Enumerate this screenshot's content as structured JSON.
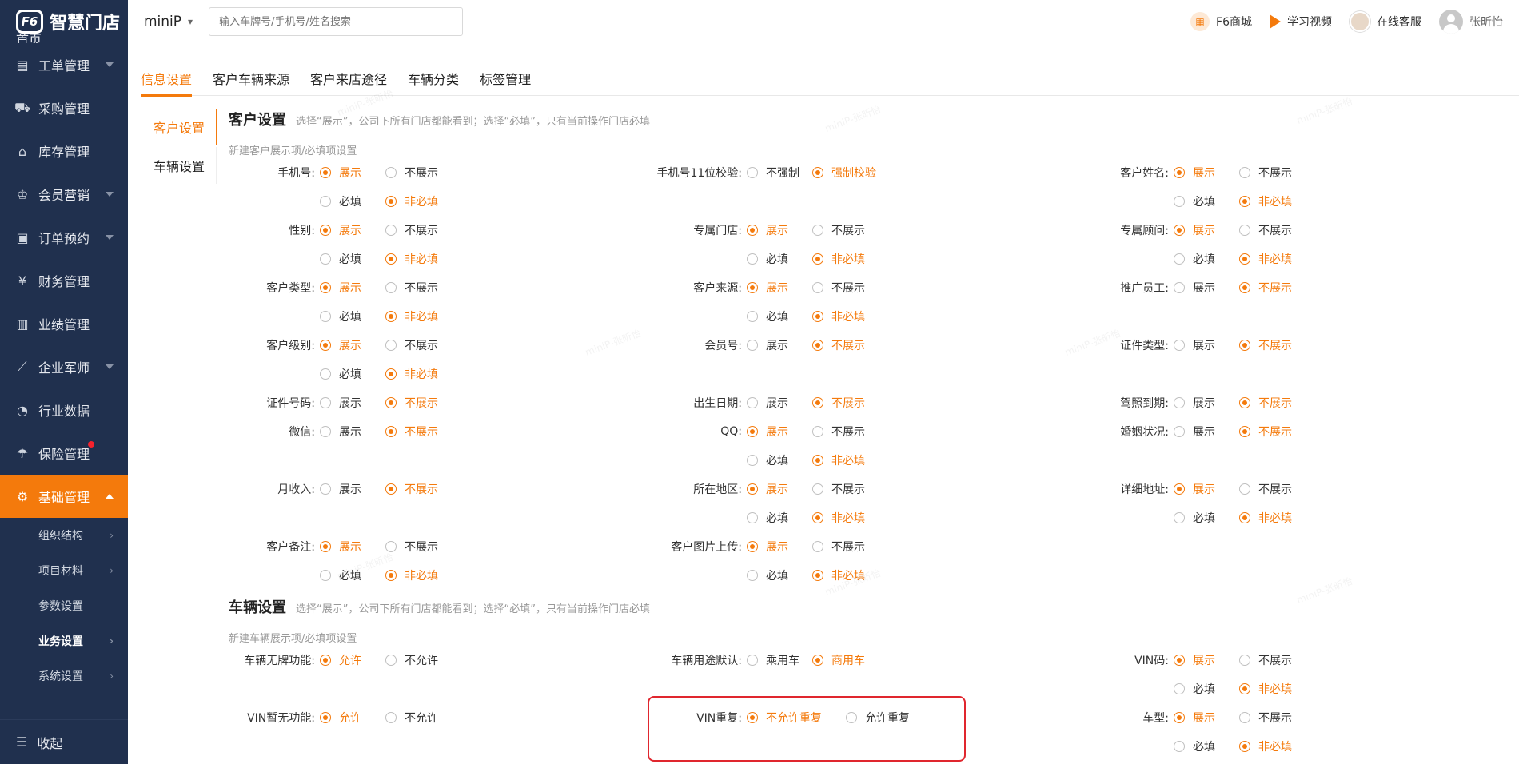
{
  "brand": {
    "name": "智慧门店"
  },
  "sidebar": {
    "partial_item": "首页",
    "items": [
      {
        "label": "工单管理",
        "icon": "doc-icon",
        "caret": true
      },
      {
        "label": "采购管理",
        "icon": "cart-icon",
        "caret": false
      },
      {
        "label": "库存管理",
        "icon": "house-icon",
        "caret": false
      },
      {
        "label": "会员营销",
        "icon": "crown-icon",
        "caret": true
      },
      {
        "label": "订单预约",
        "icon": "clipboard-icon",
        "caret": true
      },
      {
        "label": "财务管理",
        "icon": "yen-icon",
        "caret": false
      },
      {
        "label": "业绩管理",
        "icon": "bar-chart-icon",
        "caret": false
      },
      {
        "label": "企业军师",
        "icon": "trend-icon",
        "caret": true
      },
      {
        "label": "行业数据",
        "icon": "gauge-icon",
        "caret": false
      },
      {
        "label": "保险管理",
        "icon": "umbrella-icon",
        "caret": false
      },
      {
        "label": "基础管理",
        "icon": "gear-icon",
        "caret": true
      }
    ],
    "sub_items": [
      "组织结构",
      "项目材料",
      "参数设置",
      "业务设置",
      "系统设置"
    ],
    "collapse_label": "收起"
  },
  "topbar": {
    "store": "miniP",
    "search_placeholder": "输入车牌号/手机号/姓名搜索",
    "links": {
      "mall": "F6商城",
      "video": "学习视频",
      "service": "在线客服"
    },
    "user": "张昕怡"
  },
  "tabs": [
    "信息设置",
    "客户车辆来源",
    "客户来店途径",
    "车辆分类",
    "标签管理"
  ],
  "subnav": [
    "客户设置",
    "车辆设置"
  ],
  "customer": {
    "title": "客户设置",
    "hint": "选择“展示”，公司下所有门店都能看到；选择“必填”，只有当前操作门店必填",
    "sub": "新建客户展示项/必填项设置",
    "c1": [
      {
        "label": "手机号:",
        "show": "展示",
        "hide": "不展示",
        "req": "必填",
        "opt": "非必填"
      },
      {
        "label": "性别:",
        "show": "展示",
        "hide": "不展示",
        "req": "必填",
        "opt": "非必填"
      },
      {
        "label": "客户类型:",
        "show": "展示",
        "hide": "不展示",
        "req": "必填",
        "opt": "非必填"
      },
      {
        "label": "客户级别:",
        "show": "展示",
        "hide": "不展示",
        "req": "必填",
        "opt": "非必填"
      },
      {
        "label": "证件号码:",
        "show": "展示",
        "hide": "不展示"
      },
      {
        "label": "微信:",
        "show": "展示",
        "hide": "不展示"
      },
      {
        "label": "月收入:",
        "show": "展示",
        "hide": "不展示"
      },
      {
        "label": "客户备注:",
        "show": "展示",
        "hide": "不展示",
        "req": "必填",
        "opt": "非必填"
      }
    ],
    "c2": [
      {
        "label": "手机号11位校验:",
        "a": "不强制",
        "b": "强制校验"
      },
      {
        "label": "专属门店:",
        "show": "展示",
        "hide": "不展示",
        "req": "必填",
        "opt": "非必填"
      },
      {
        "label": "客户来源:",
        "show": "展示",
        "hide": "不展示",
        "req": "必填",
        "opt": "非必填"
      },
      {
        "label": "会员号:",
        "show": "展示",
        "hide": "不展示"
      },
      {
        "label": "出生日期:",
        "show": "展示",
        "hide": "不展示"
      },
      {
        "label": "QQ:",
        "show": "展示",
        "hide": "不展示",
        "req": "必填",
        "opt": "非必填"
      },
      {
        "label": "所在地区:",
        "show": "展示",
        "hide": "不展示",
        "req": "必填",
        "opt": "非必填"
      },
      {
        "label": "客户图片上传:",
        "show": "展示",
        "hide": "不展示",
        "req": "必填",
        "opt": "非必填"
      }
    ],
    "c3": [
      {
        "label": "客户姓名:",
        "show": "展示",
        "hide": "不展示",
        "req": "必填",
        "opt": "非必填"
      },
      {
        "label": "专属顾问:",
        "show": "展示",
        "hide": "不展示",
        "req": "必填",
        "opt": "非必填"
      },
      {
        "label": "推广员工:",
        "show": "展示",
        "hide": "不展示"
      },
      {
        "label": "证件类型:",
        "show": "展示",
        "hide": "不展示"
      },
      {
        "label": "驾照到期:",
        "show": "展示",
        "hide": "不展示"
      },
      {
        "label": "婚姻状况:",
        "show": "展示",
        "hide": "不展示"
      },
      {
        "label": "详细地址:",
        "show": "展示",
        "hide": "不展示",
        "req": "必填",
        "opt": "非必填"
      }
    ]
  },
  "vehicle": {
    "title": "车辆设置",
    "hint": "选择“展示”，公司下所有门店都能看到；选择“必填”，只有当前操作门店必填",
    "sub": "新建车辆展示项/必填项设置",
    "no_plate": {
      "label": "车辆无牌功能:",
      "a": "允许",
      "b": "不允许"
    },
    "usage": {
      "label": "车辆用途默认:",
      "a": "乘用车",
      "b": "商用车"
    },
    "vin": {
      "label": "VIN码:",
      "show": "展示",
      "hide": "不展示",
      "req": "必填",
      "opt": "非必填"
    },
    "vin_none": {
      "label": "VIN暂无功能:",
      "a": "允许",
      "b": "不允许"
    },
    "vin_dup": {
      "label": "VIN重复:",
      "a": "不允许重复",
      "b": "允许重复"
    },
    "model": {
      "label": "车型:",
      "show": "展示",
      "hide": "不展示",
      "req": "必填",
      "opt": "非必填"
    }
  },
  "watermark": "miniP-张昕怡",
  "colors": {
    "accent": "#f47a0c",
    "sidebar": "#20304e",
    "highlight": "#e0262e"
  }
}
